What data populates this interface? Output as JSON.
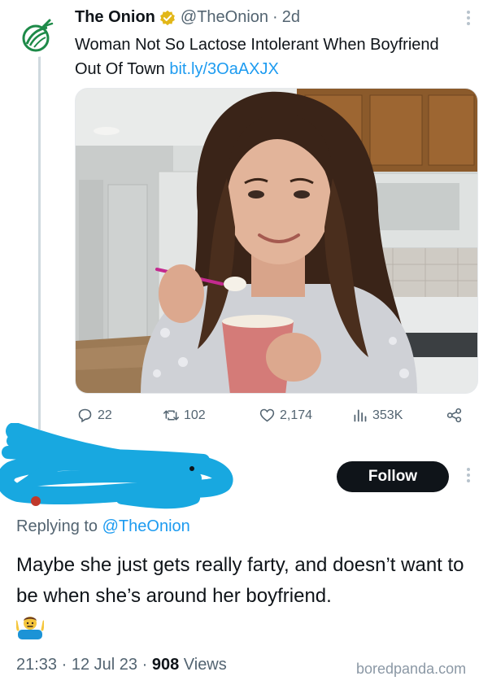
{
  "tweet": {
    "author_name": "The Onion",
    "handle": "@TheOnion",
    "time_sep": "·",
    "time": "2d",
    "text": "Woman Not So Lactose Intolerant When Boyfriend Out Of Town ",
    "link": "bit.ly/3OaAXJX",
    "stats": {
      "replies": "22",
      "retweets": "102",
      "likes": "2,174",
      "views": "353K"
    }
  },
  "reply": {
    "follow_label": "Follow",
    "replying_prefix": "Replying to ",
    "replying_handle": "@TheOnion",
    "text": "Maybe she just gets really farty, and doesn’t want to be when she’s around her boyfriend.",
    "emoji": "🤷‍♂️",
    "time": "21:33",
    "date": "12 Jul 23",
    "sep": "·",
    "views_count": "908",
    "views_label": "Views"
  },
  "watermark": "boredpanda.com",
  "colors": {
    "link": "#1d9bf0",
    "secondary_text": "#536471",
    "onion_green": "#1d8a48",
    "verified_gold": "#e2b719",
    "scribble": "#18a8e0",
    "follow_bg": "#0f1419"
  }
}
